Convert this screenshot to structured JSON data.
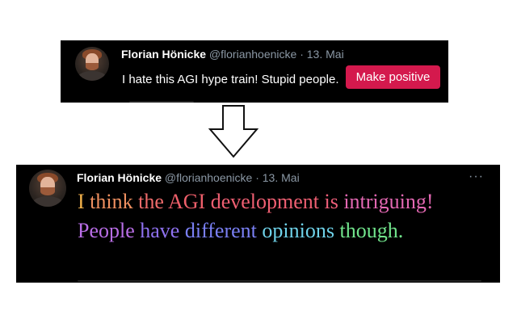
{
  "top_tweet": {
    "author_name": "Florian Hönicke",
    "handle": "@florianhoenicke",
    "separator": "·",
    "date": "13. Mai",
    "text": "I hate this AGI hype train! Stupid people.",
    "button_label": "Make positive",
    "button_color": "#d4194d"
  },
  "bottom_tweet": {
    "author_name": "Florian Hönicke",
    "handle": "@florianhoenicke",
    "separator": "·",
    "date": "13. Mai",
    "more_icon": "···",
    "text": "I think the AGI development is intriguing! People have different opinions though.",
    "words": [
      {
        "text": "I",
        "color": "#f2b14a"
      },
      {
        "text": "think",
        "color": "#f09060"
      },
      {
        "text": "the",
        "color": "#ef6b6b"
      },
      {
        "text": "AGI",
        "color": "#ee5f6a"
      },
      {
        "text": "development",
        "color": "#ef5f72"
      },
      {
        "text": "is",
        "color": "#ee5f7a"
      },
      {
        "text": "intriguing!",
        "color": "#e468b3"
      },
      {
        "text": "People",
        "color": "#b96ee6"
      },
      {
        "text": "have",
        "color": "#8f72f0"
      },
      {
        "text": "different",
        "color": "#7a80f5"
      },
      {
        "text": "opinions",
        "color": "#6fd3ea"
      },
      {
        "text": "though.",
        "color": "#71e58c"
      }
    ]
  },
  "arrow": {
    "icon": "down-arrow-icon",
    "fill": "#ffffff",
    "stroke": "#111111"
  }
}
